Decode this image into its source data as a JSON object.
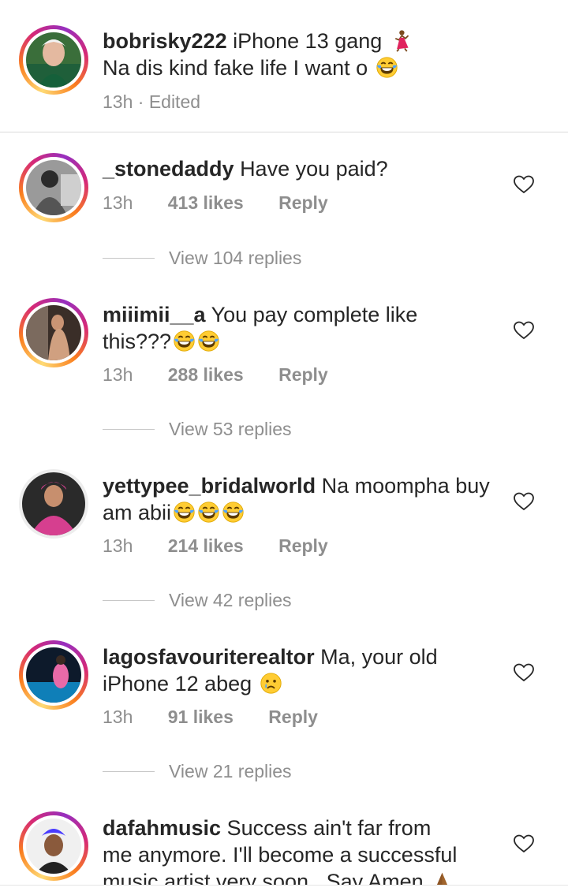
{
  "caption": {
    "username": "bobrisky222",
    "line1": "iPhone 13 gang",
    "line2": "Na dis kind fake life I want o",
    "time": "13h · Edited"
  },
  "comments": [
    {
      "username": "_stonedaddy",
      "text_line1": "Have you paid?",
      "text_line2": "",
      "time": "13h",
      "likes": "413 likes",
      "reply": "Reply",
      "view_replies": "View 104 replies"
    },
    {
      "username": "miiimii__a",
      "text_line1": "You pay complete like",
      "text_line2": "this???",
      "time": "13h",
      "likes": "288 likes",
      "reply": "Reply",
      "view_replies": "View 53 replies"
    },
    {
      "username": "yettypee_bridalworld",
      "text_line1": "Na moompha buy",
      "text_line2": "am abii",
      "time": "13h",
      "likes": "214 likes",
      "reply": "Reply",
      "view_replies": "View 42 replies"
    },
    {
      "username": "lagosfavouriterealtor",
      "text_line1": "Ma, your old",
      "text_line2": "iPhone 12 abeg",
      "time": "13h",
      "likes": "91 likes",
      "reply": "Reply",
      "view_replies": "View 21 replies"
    },
    {
      "username": "dafahmusic",
      "text_line1": "Success ain't far from",
      "text_line2": "me anymore. I'll become a successful",
      "text_line3": "music artist very soon . Say Amen"
    }
  ],
  "icons": {
    "like": "heart-outline-icon",
    "laugh": "face-with-tears-of-joy-emoji",
    "dancer": "dancer-emoji",
    "crying": "crying-face-emoji",
    "pray": "folded-hands-emoji"
  },
  "colors": {
    "story_ring_start": "#feda75",
    "story_ring_mid": "#d62976",
    "story_ring_end": "#962fbf",
    "muted_text": "#8e8e8e",
    "primary_text": "#262626"
  }
}
